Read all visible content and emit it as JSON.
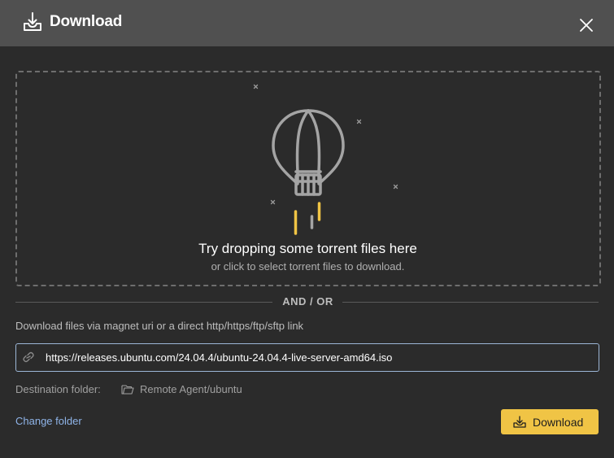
{
  "dialog": {
    "title": "Download",
    "header_icon": "download-tray-icon",
    "close_icon": "close-icon"
  },
  "dropzone": {
    "title": "Try dropping some torrent files here",
    "subtitle": "or click to select torrent files to download.",
    "illustration": "hot-air-balloon-icon"
  },
  "divider": {
    "label": "AND / OR"
  },
  "url_section": {
    "instructions": "Download files via magnet uri or a direct http/https/ftp/sftp link",
    "value": "https://releases.ubuntu.com/24.04.4/ubuntu-24.04.4-live-server-amd64.iso",
    "icon": "link-icon"
  },
  "destination": {
    "label": "Destination folder:",
    "path": "Remote Agent/ubuntu",
    "icon": "folder-icon"
  },
  "actions": {
    "change_folder": "Change folder",
    "download": "Download"
  },
  "colors": {
    "header_bg": "#505050",
    "body_bg": "#2b2b2b",
    "accent": "#f0c445",
    "link": "#8fb4e8",
    "input_border": "#9cb6d6"
  }
}
